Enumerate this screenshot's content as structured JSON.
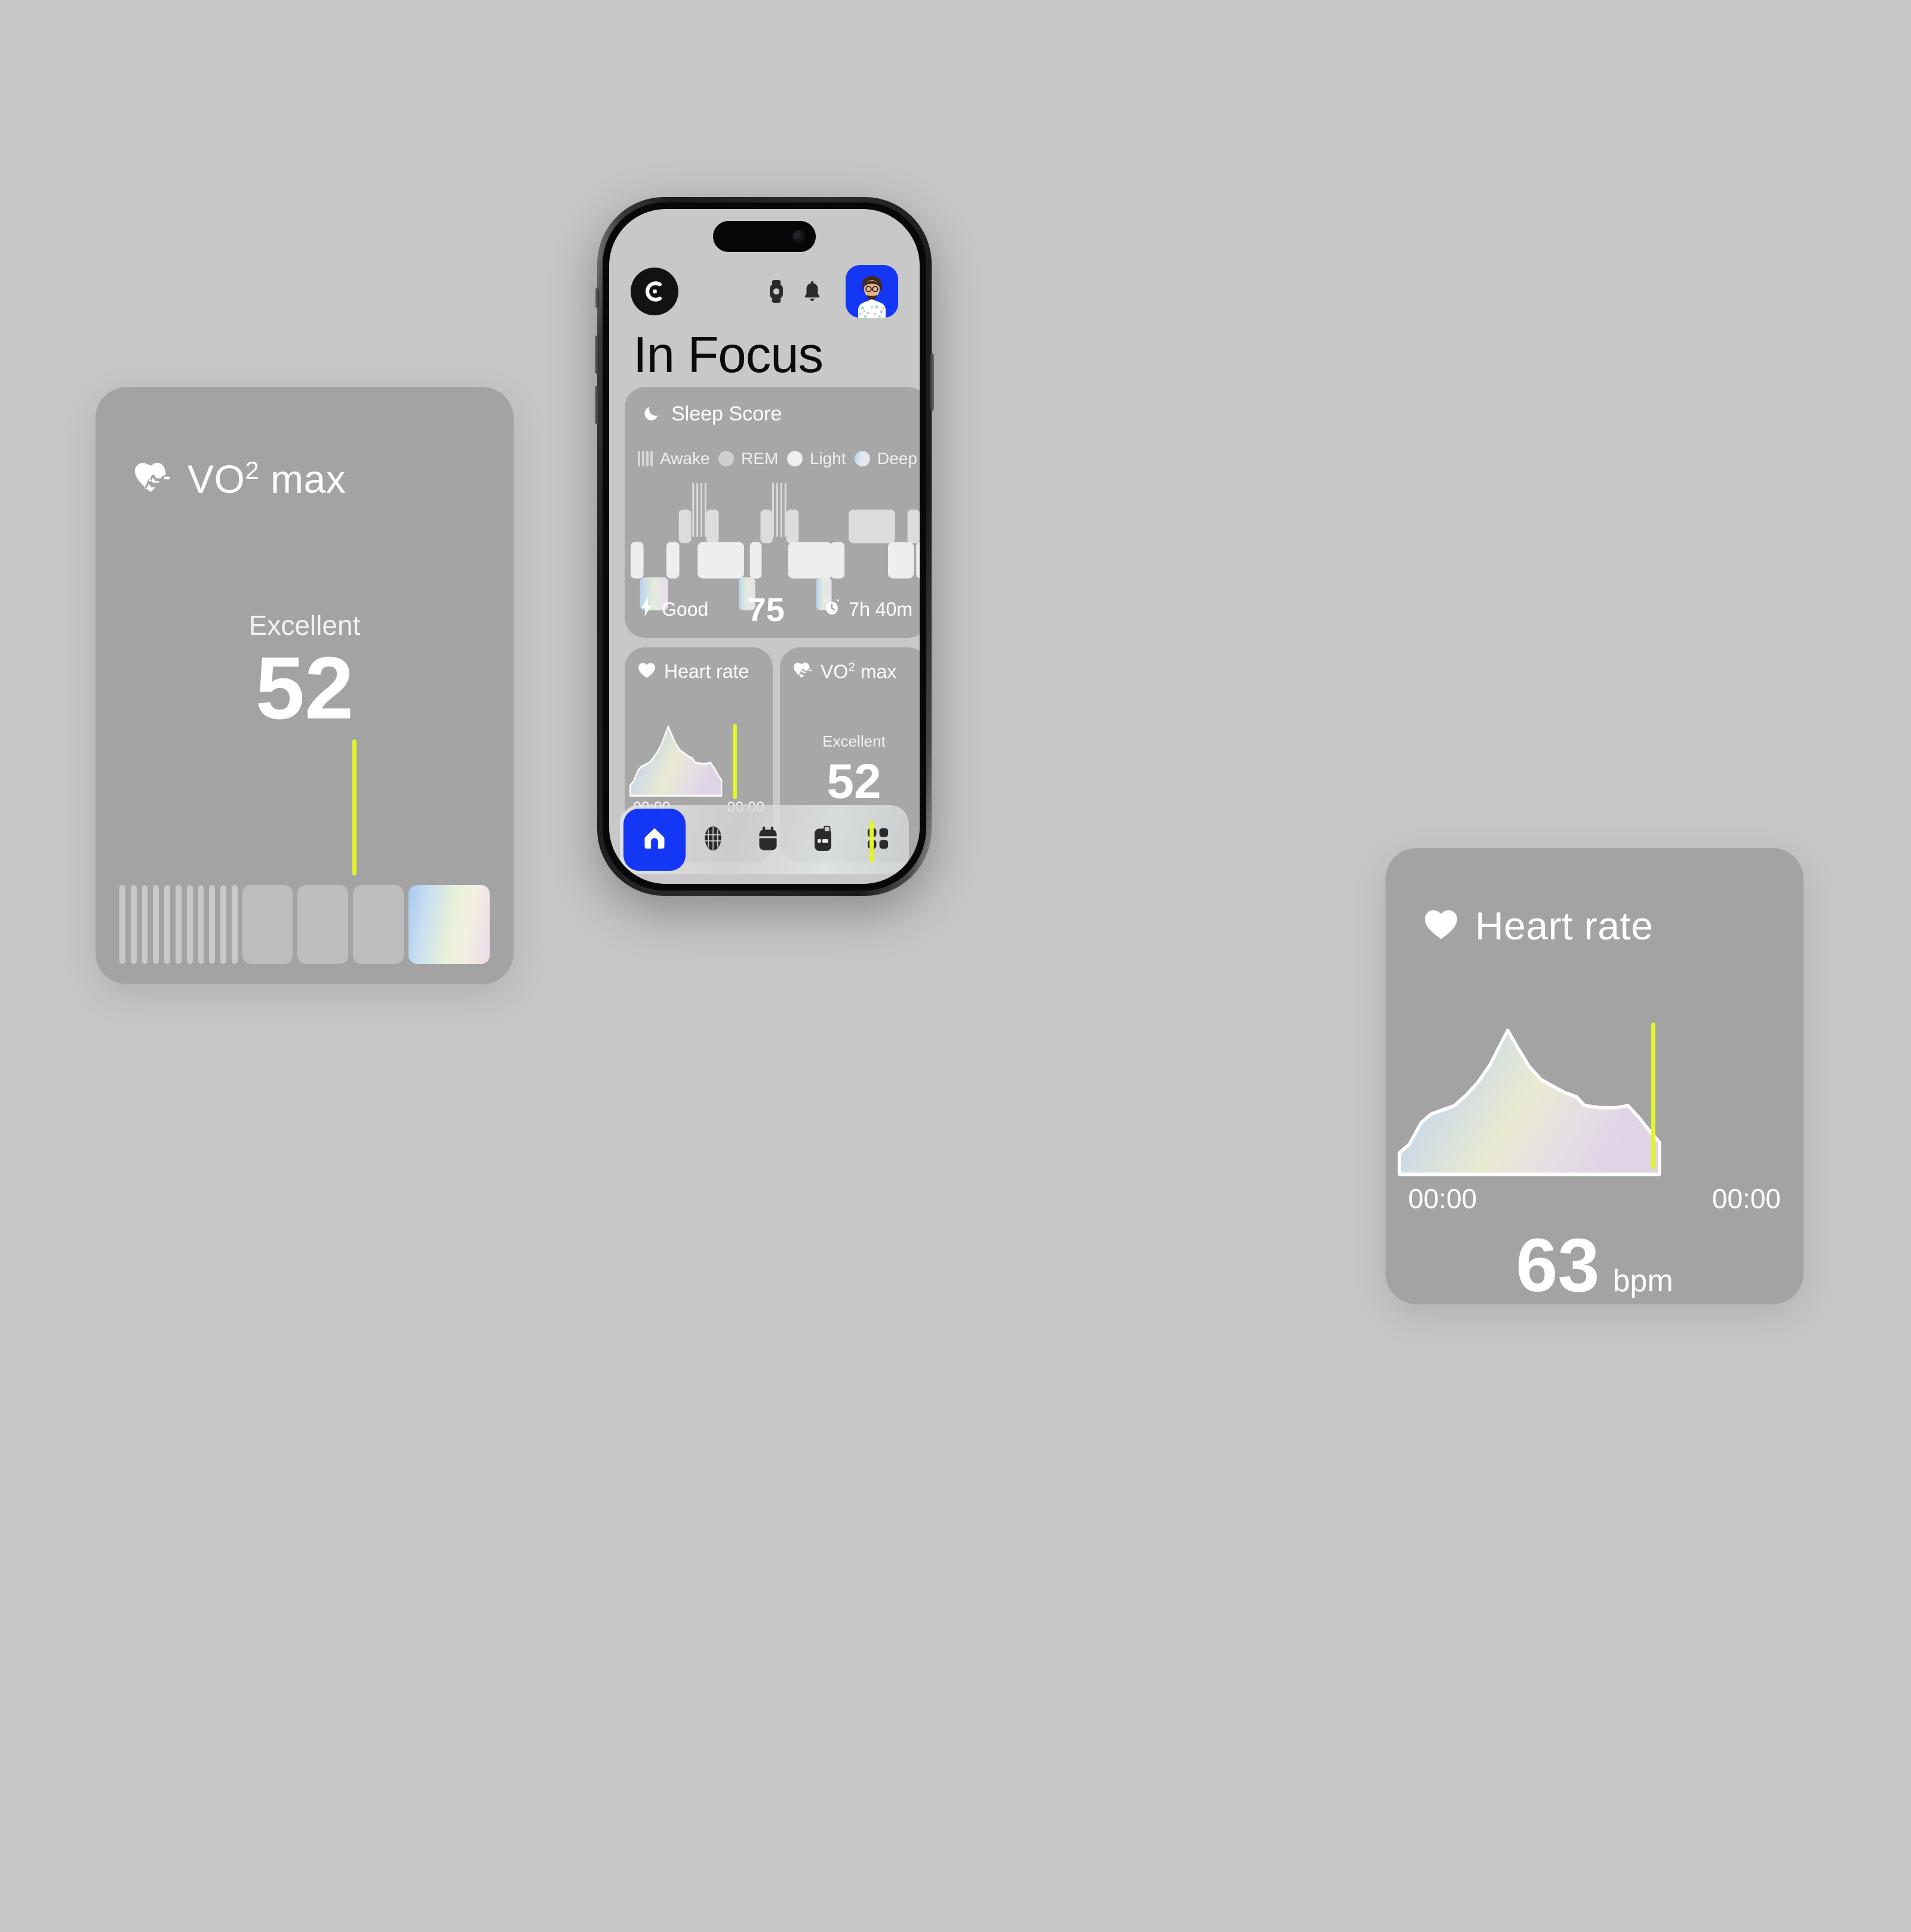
{
  "background_color": "#c6c6c6",
  "accent_blue": "#1436f5",
  "marker_yellow": "#e2f52a",
  "phone": {
    "header": {
      "logo_icon": "brand-c-logo-icon",
      "watch_icon": "smartwatch-icon",
      "bell_icon": "bell-icon",
      "avatar_label": "user-avatar"
    },
    "page_title": "In Focus",
    "sleep_card": {
      "icon": "moon-icon",
      "title": "Sleep Score",
      "legend": [
        {
          "key": "awake",
          "label": "Awake",
          "marker": "stripes"
        },
        {
          "key": "rem",
          "label": "REM",
          "marker": "dot",
          "color": "#cfcfcf"
        },
        {
          "key": "light",
          "label": "Light",
          "marker": "dot",
          "color": "#efefef"
        },
        {
          "key": "deep",
          "label": "Deep",
          "marker": "gradient-dot"
        }
      ],
      "footer": {
        "quality_icon": "lightning-bolt-icon",
        "quality_label": "Good",
        "score": "75",
        "duration_icon": "alarm-clock-icon",
        "duration_label": "7h 40m"
      }
    },
    "heart_rate_card": {
      "icon": "heart-icon",
      "title": "Heart rate",
      "time_start": "00:00",
      "time_end": "00:00"
    },
    "vo2_card": {
      "icon": "heart-pulse-icon",
      "title": "VO",
      "title_sup": "2",
      "title_rest": " max",
      "rating": "Excellent",
      "value": "52"
    },
    "tabbar": [
      {
        "name": "home",
        "icon": "home-icon",
        "active": true
      },
      {
        "name": "rewards",
        "icon": "diamond-icon",
        "active": false
      },
      {
        "name": "calendar",
        "icon": "calendar-icon",
        "active": false
      },
      {
        "name": "reports",
        "icon": "clipboard-icon",
        "active": false
      },
      {
        "name": "more",
        "icon": "grid-icon",
        "active": false
      }
    ]
  },
  "vo2_widget": {
    "icon": "heart-pulse-icon",
    "title": "VO",
    "title_sup": "2",
    "title_rest": " max",
    "rating": "Excellent",
    "value": "52"
  },
  "hr_widget": {
    "icon": "heart-icon",
    "title": "Heart rate",
    "time_start": "00:00",
    "time_end": "00:00",
    "value": "63",
    "unit": "bpm"
  },
  "chart_data": [
    {
      "type": "area",
      "name": "heart-rate-trend",
      "title": "Heart rate",
      "xlabel": "",
      "ylabel": "bpm",
      "x_tick_labels": [
        "00:00",
        "00:00"
      ],
      "current_value": 63,
      "unit": "bpm",
      "marker_x_fraction": 0.78,
      "y": [
        16,
        34,
        47,
        52,
        56,
        63,
        60,
        70,
        86,
        100,
        82,
        70,
        63,
        58,
        57,
        57,
        58,
        52,
        40,
        33
      ],
      "ylim": [
        0,
        100
      ],
      "grid": false,
      "legend": "none"
    },
    {
      "type": "bar",
      "name": "vo2max-range-scale",
      "title": "VO2 max",
      "rating": "Excellent",
      "value": 52,
      "categories": [
        "poor",
        "fair",
        "average",
        "good",
        "excellent"
      ],
      "segment_styles": [
        "stripes",
        "solid",
        "solid",
        "solid",
        "gradient"
      ],
      "marker_segment_index": 3,
      "grid": false,
      "legend": "none"
    },
    {
      "type": "bar",
      "name": "sleep-hypnogram",
      "title": "Sleep Score",
      "score": 75,
      "quality": "Good",
      "duration": "7h 40m",
      "stages": [
        "Awake",
        "REM",
        "Light",
        "Deep"
      ],
      "stage_levels": [
        0,
        1,
        2,
        3
      ],
      "segments": [
        {
          "stage": "Light",
          "start": 0.0,
          "end": 0.055
        },
        {
          "stage": "Deep",
          "start": 0.035,
          "end": 0.135
        },
        {
          "stage": "Light",
          "start": 0.125,
          "end": 0.175
        },
        {
          "stage": "REM",
          "start": 0.165,
          "end": 0.225
        },
        {
          "stage": "Awake",
          "start": 0.205,
          "end": 0.245
        },
        {
          "stage": "REM",
          "start": 0.245,
          "end": 0.295
        },
        {
          "stage": "Light",
          "start": 0.275,
          "end": 0.415
        },
        {
          "stage": "Deep",
          "start": 0.345,
          "end": 0.445
        },
        {
          "stage": "REM",
          "start": 0.435,
          "end": 0.485
        },
        {
          "stage": "Awake",
          "start": 0.475,
          "end": 0.515
        },
        {
          "stage": "REM",
          "start": 0.515,
          "end": 0.575
        },
        {
          "stage": "Light",
          "start": 0.565,
          "end": 0.685
        },
        {
          "stage": "Deep",
          "start": 0.645,
          "end": 0.725
        },
        {
          "stage": "Light",
          "start": 0.715,
          "end": 0.775
        },
        {
          "stage": "REM",
          "start": 0.765,
          "end": 0.905
        },
        {
          "stage": "Light",
          "start": 0.885,
          "end": 0.955
        },
        {
          "stage": "REM",
          "start": 0.945,
          "end": 0.985
        },
        {
          "stage": "Light",
          "start": 0.975,
          "end": 1.0
        }
      ],
      "grid": false,
      "legend": "top"
    }
  ]
}
